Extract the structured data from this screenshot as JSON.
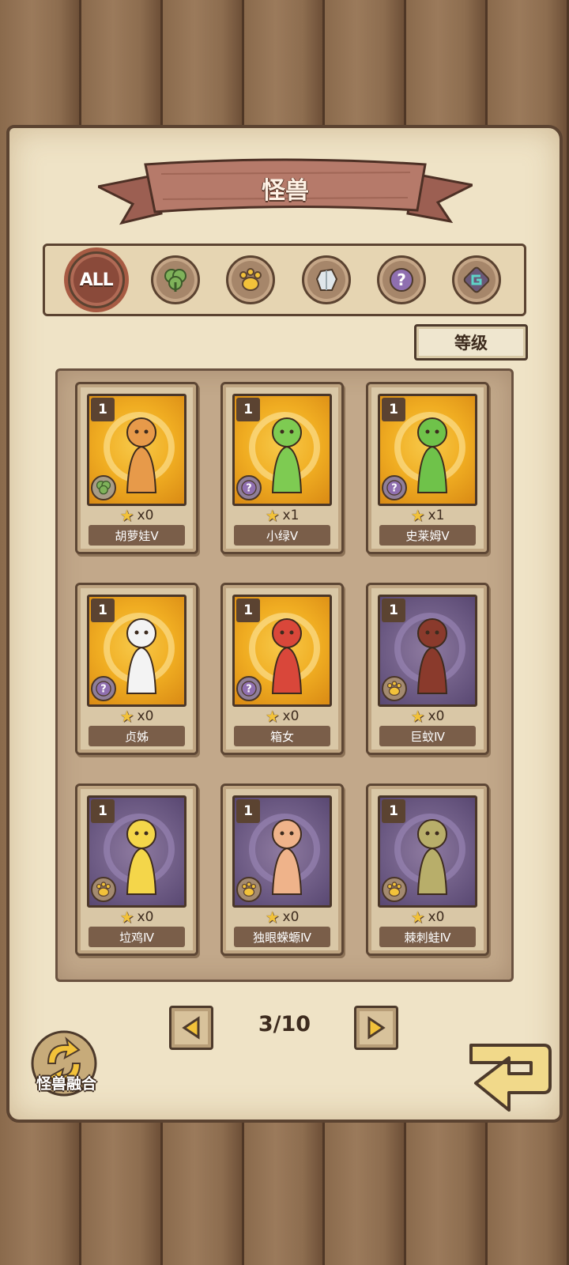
{
  "header": {
    "title": "怪兽"
  },
  "filters": {
    "all_label": "ALL",
    "items": [
      {
        "icon": "all-icon",
        "active": true
      },
      {
        "icon": "leaf-icon",
        "active": false
      },
      {
        "icon": "paw-icon",
        "active": false
      },
      {
        "icon": "crystal-icon",
        "active": false
      },
      {
        "icon": "question-icon",
        "active": false
      },
      {
        "icon": "spiral-icon",
        "active": false
      }
    ]
  },
  "sort": {
    "label": "等级"
  },
  "cards": [
    {
      "level": "1",
      "count": "x0",
      "name": "胡萝娃Ⅴ",
      "rarity": "rare",
      "type_icon": "leaf-icon"
    },
    {
      "level": "1",
      "count": "x1",
      "name": "小绿Ⅴ",
      "rarity": "rare",
      "type_icon": "question-icon"
    },
    {
      "level": "1",
      "count": "x1",
      "name": "史莱姆Ⅴ",
      "rarity": "rare",
      "type_icon": "question-icon"
    },
    {
      "level": "1",
      "count": "x0",
      "name": "贞姊",
      "rarity": "rare",
      "type_icon": "question-icon"
    },
    {
      "level": "1",
      "count": "x0",
      "name": "箱女",
      "rarity": "rare",
      "type_icon": "question-icon"
    },
    {
      "level": "1",
      "count": "x0",
      "name": "巨蚊Ⅳ",
      "rarity": "common",
      "type_icon": "paw-icon"
    },
    {
      "level": "1",
      "count": "x0",
      "name": "垃鸡Ⅳ",
      "rarity": "common",
      "type_icon": "paw-icon"
    },
    {
      "level": "1",
      "count": "x0",
      "name": "独眼蝾螈Ⅳ",
      "rarity": "common",
      "type_icon": "paw-icon"
    },
    {
      "level": "1",
      "count": "x0",
      "name": "棘刺蛙Ⅳ",
      "rarity": "common",
      "type_icon": "paw-icon"
    }
  ],
  "pagination": {
    "label": "3/10",
    "current": 3,
    "total": 10
  },
  "fuse": {
    "label": "怪兽融合"
  },
  "colors": {
    "paper": "#efe3c6",
    "wood": "#8a6a4c",
    "banner": "#b67a6a",
    "rare_bg": "#f0ad22",
    "common_bg": "#6e5c85",
    "name_plate": "#7a5e49"
  }
}
